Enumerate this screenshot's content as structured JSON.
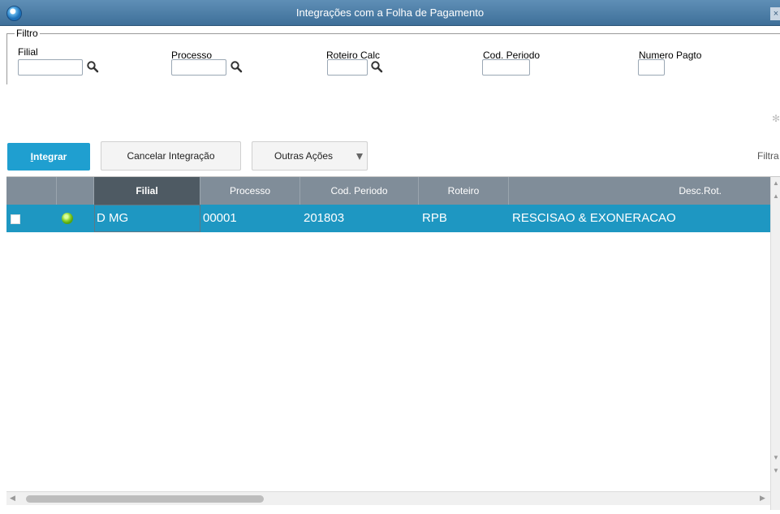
{
  "window": {
    "title": "Integrações com a Folha de Pagamento",
    "close_glyph": "×"
  },
  "filtro": {
    "legend": "Filtro",
    "fields": [
      {
        "label": "Filial",
        "value": ""
      },
      {
        "label": "Processo",
        "value": ""
      },
      {
        "label": "Roteiro Calc",
        "value": ""
      },
      {
        "label": "Cod. Periodo",
        "value": ""
      },
      {
        "label": "Numero Pagto",
        "value": ""
      }
    ]
  },
  "toolbar": {
    "integrar_first": "I",
    "integrar_rest": "ntegrar",
    "cancelar": "Cancelar Integração",
    "outras": "Outras Ações",
    "filtrar": "Filtra"
  },
  "grid": {
    "columns": [
      "Filial",
      "Processo",
      "Cod. Periodo",
      "Roteiro",
      "Desc.Rot."
    ],
    "rows": [
      {
        "status": "green",
        "filial": "D MG",
        "processo": "00001",
        "cod_periodo": "201803",
        "roteiro": "RPB",
        "desc_rot": "RESCISAO & EXONERACAO"
      }
    ]
  },
  "icons": {
    "search": "search-icon",
    "gear": "gear-icon",
    "app": "app-icon"
  },
  "colors": {
    "titlebar": "#3e6f99",
    "accent": "#1f9fd0",
    "row_selected": "#1e97c2",
    "header": "#808d99",
    "status_ok": "#8fd42f"
  }
}
